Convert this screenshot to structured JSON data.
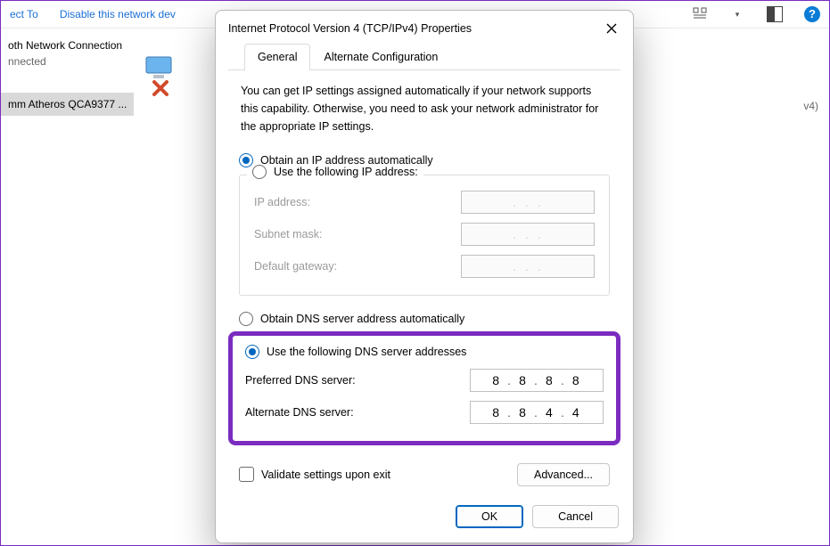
{
  "background": {
    "toolbar_items": [
      "ect To",
      "Disable this network dev"
    ],
    "v4_trail": "v4)",
    "adapters": [
      {
        "name": "oth Network Connection",
        "status": "nnected"
      },
      {
        "name": "",
        "status": "mm Atheros QCA9377 ..."
      }
    ]
  },
  "dialog": {
    "title": "Internet Protocol Version 4 (TCP/IPv4) Properties",
    "tabs": {
      "general": "General",
      "alt": "Alternate Configuration"
    },
    "hint": "You can get IP settings assigned automatically if your network supports this capability. Otherwise, you need to ask your network administrator for the appropriate IP settings.",
    "ip_auto": "Obtain an IP address automatically",
    "ip_manual": "Use the following IP address:",
    "ip_labels": {
      "ip": "IP address:",
      "mask": "Subnet mask:",
      "gw": "Default gateway:"
    },
    "dns_auto": "Obtain DNS server address automatically",
    "dns_manual": "Use the following DNS server addresses",
    "dns_labels": {
      "pref": "Preferred DNS server:",
      "alt": "Alternate DNS server:"
    },
    "dns_values": {
      "pref": [
        "8",
        "8",
        "8",
        "8"
      ],
      "alt": [
        "8",
        "8",
        "4",
        "4"
      ]
    },
    "validate": "Validate settings upon exit",
    "advanced": "Advanced...",
    "ok": "OK",
    "cancel": "Cancel"
  }
}
